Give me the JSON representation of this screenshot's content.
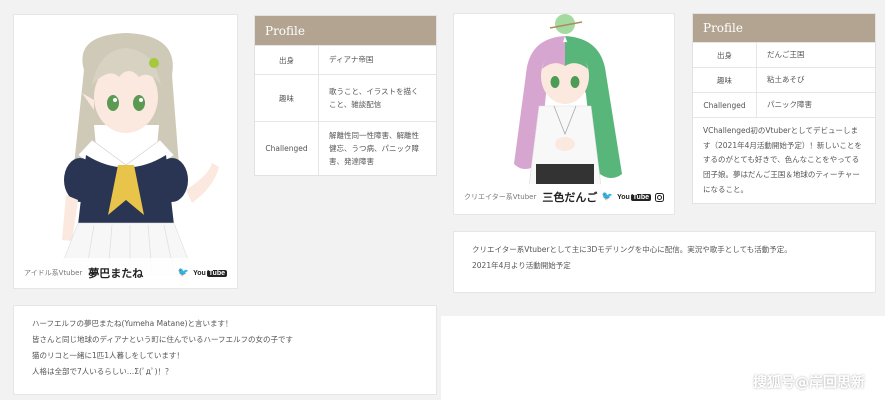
{
  "left_card": {
    "role": "アイドル系Vtuber",
    "name": "夢巴またね",
    "youtube_label": "You",
    "youtube_box": "Tube",
    "icons": [
      "twitter-icon",
      "youtube-icon"
    ]
  },
  "left_profile": {
    "header": "Profile",
    "rows": [
      {
        "key": "出身",
        "value": "ディアナ帝国"
      },
      {
        "key": "趣味",
        "value": "歌うこと、イラストを描くこと、雑談配信"
      },
      {
        "key": "Challenged",
        "value": "解離性同一性障害、解離性健忘、うつ病、パニック障害、発達障害"
      }
    ]
  },
  "right_card": {
    "role": "クリエイター系Vtuber",
    "name": "三色だんご",
    "youtube_label": "You",
    "youtube_box": "Tube",
    "icons": [
      "twitter-icon",
      "youtube-icon",
      "instagram-icon"
    ]
  },
  "right_profile": {
    "header": "Profile",
    "rows": [
      {
        "key": "出身",
        "value": "だんご王国"
      },
      {
        "key": "趣味",
        "value": "粘土あそび"
      },
      {
        "key": "Challenged",
        "value": "パニック障害"
      }
    ],
    "description": "VChallenged初のVtuberとしてデビューします（2021年4月活動開始予定）！新しいことをするのがとても好きで、色んなことをやってる団子娘。夢はだんご王国＆地球のティーチャーになること。"
  },
  "right_bio": {
    "lines": [
      "クリエイター系Vtuberとして主に3Dモデリングを中心に配信。実況や歌手としても活動予定。",
      "2021年4月より活動開始予定"
    ]
  },
  "left_bio": {
    "lines": [
      "ハーフエルフの夢巴またね(Yumeha Matane)と言います！",
      "皆さんと同じ地球のディアナという町に住んでいるハーフエルフの女の子です",
      "猫のリコと一緒に1匹1人暮しをしています！",
      "人格は全部で7人いるらしい…Σ(ﾟдﾟ)！？"
    ]
  },
  "watermark": "搜狐号@岸回思新",
  "colors": {
    "page_bg": "#f2f2f2",
    "profile_header": "#b3a492",
    "card_bg": "#ffffff"
  }
}
